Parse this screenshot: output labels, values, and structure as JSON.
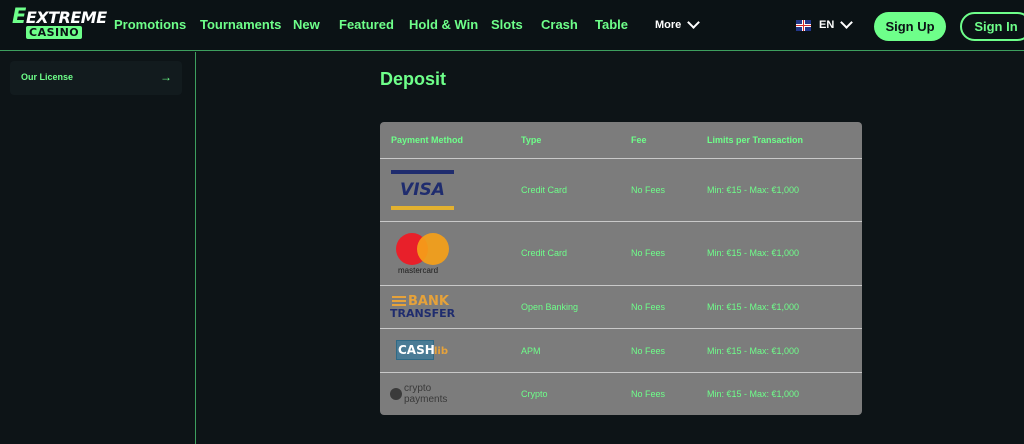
{
  "header": {
    "logo": {
      "line1": "EXTREME",
      "line2": "CASINO"
    },
    "nav": [
      "Promotions",
      "Tournaments",
      "New",
      "Featured",
      "Hold & Win",
      "Slots",
      "Crash",
      "Table"
    ],
    "more_label": "More",
    "language": "EN",
    "signup_label": "Sign Up",
    "signin_label": "Sign In"
  },
  "sidebar": {
    "items": [
      {
        "label": "Our License",
        "icon": "arrow-right-icon"
      }
    ]
  },
  "main": {
    "title": "Deposit",
    "table": {
      "columns": [
        "Payment Method",
        "Type",
        "Fee",
        "Limits per Transaction"
      ],
      "rows": [
        {
          "method": "VISA",
          "type": "Credit Card",
          "fee": "No Fees",
          "limits": "Min: €15 - Max: €1,000"
        },
        {
          "method": "mastercard",
          "type": "Credit Card",
          "fee": "No Fees",
          "limits": "Min: €15 - Max: €1,000"
        },
        {
          "method": "BANK TRANSFER",
          "type": "Open Banking",
          "fee": "No Fees",
          "limits": "Min: €15 - Max: €1,000"
        },
        {
          "method": "CASHlib",
          "type": "APM",
          "fee": "No Fees",
          "limits": "Min: €15 - Max: €1,000"
        },
        {
          "method": "crypto payments",
          "type": "Crypto",
          "fee": "No Fees",
          "limits": "Min: €15 - Max: €1,000"
        }
      ],
      "logos": {
        "visa": "VISA",
        "mastercard": "mastercard",
        "bank_1": "BANK",
        "bank_2": "TRANSFER",
        "cashlib_1": "CASH",
        "cashlib_2": "lib",
        "crypto_1": "crypto",
        "crypto_2": "payments"
      }
    }
  },
  "colors": {
    "accent": "#6eff8a",
    "background": "#0d1417",
    "table_bg": "#7c7c7c"
  }
}
